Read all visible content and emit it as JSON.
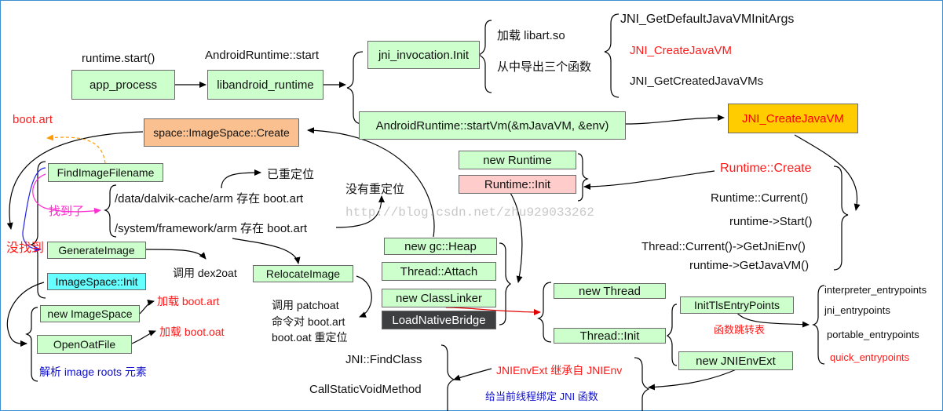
{
  "boxes": {
    "app_process": "app_process",
    "libandroid_runtime": "libandroid_runtime",
    "jni_invocation_init": "jni_invocation.Init",
    "start_vm": "AndroidRuntime::startVm(&mJavaVM, &env)",
    "jni_create_javavm": "JNI_CreateJavaVM",
    "image_space_create": "space::ImageSpace::Create",
    "find_image_filename": "FindImageFilename",
    "generate_image": "GenerateImage",
    "image_space_init": "ImageSpace::Init",
    "new_image_space": "new ImageSpace",
    "open_oat_file": "OpenOatFile",
    "relocate_image": "RelocateImage",
    "new_runtime": "new Runtime",
    "runtime_init": "Runtime::Init",
    "new_gc_heap": "new gc::Heap",
    "thread_attach": "Thread::Attach",
    "new_class_linker": "new ClassLinker",
    "load_native_bridge": "LoadNativeBridge",
    "new_thread": "new Thread",
    "thread_init": "Thread::Init",
    "init_tls_entry_points": "InitTlsEntryPoints",
    "new_jni_env_ext": "new JNIEnvExt"
  },
  "labels": {
    "runtime_start": "runtime.start()",
    "android_runtime_start": "AndroidRuntime::start",
    "load_libart": "加载 libart.so",
    "export_three": "从中导出三个函数",
    "get_default_args": "JNI_GetDefaultJavaVMInitArgs",
    "create_javavm_red": "JNI_CreateJavaVM",
    "get_created_vms": "JNI_GetCreatedJavaVMs",
    "boot_art": "boot.art",
    "already_relocated": "已重定位",
    "not_relocated": "没有重定位",
    "dalvik_cache": "/data/dalvik-cache/arm 存在 boot.art",
    "system_framework": "/system/framework/arm 存在 boot.art",
    "found": "找到了",
    "not_found": "没找到",
    "call_dex2oat": "调用 dex2oat",
    "load_boot_art": "加载 boot.art",
    "load_boot_oat": "加载 boot.oat",
    "parse_image_roots": "解析  image roots 元素",
    "patchoat_line1": "调用 patchoat",
    "patchoat_line2": "命令对 boot.art",
    "patchoat_line3": "boot.oat 重定位",
    "runtime_create": "Runtime::Create",
    "runtime_current": "Runtime::Current()",
    "runtime_start_call": "runtime->Start()",
    "get_jni_env": "Thread::Current()->GetJniEnv()",
    "get_javavm": "runtime->GetJavaVM()",
    "interpreter_ep": "interpreter_entrypoints",
    "jni_ep": "jni_entrypoints",
    "portable_ep": "portable_entrypoints",
    "quick_ep": "quick_entrypoints",
    "func_jump_table": "函数跳转表",
    "jni_find_class": "JNI::FindClass",
    "call_static_void": "CallStaticVoidMethod",
    "jni_env_ext_inherit": "JNIEnvExt 继承自 JNIEnv",
    "bind_jni_funcs": "给当前线程绑定 JNI 函数",
    "watermark": "http://blog.csdn.net/zhu929033262"
  },
  "colors": {
    "box_green": "#ccffcc",
    "box_orange": "#fac090",
    "box_pink": "#ffcccc",
    "box_cyan": "#66ffff",
    "box_gold": "#ffcc00",
    "box_dark": "#3d3f41",
    "text_red": "#ff1a1a",
    "text_blue": "#1010cc",
    "text_magenta": "#ff2ccf",
    "frame_blue": "#3d8fd1"
  }
}
